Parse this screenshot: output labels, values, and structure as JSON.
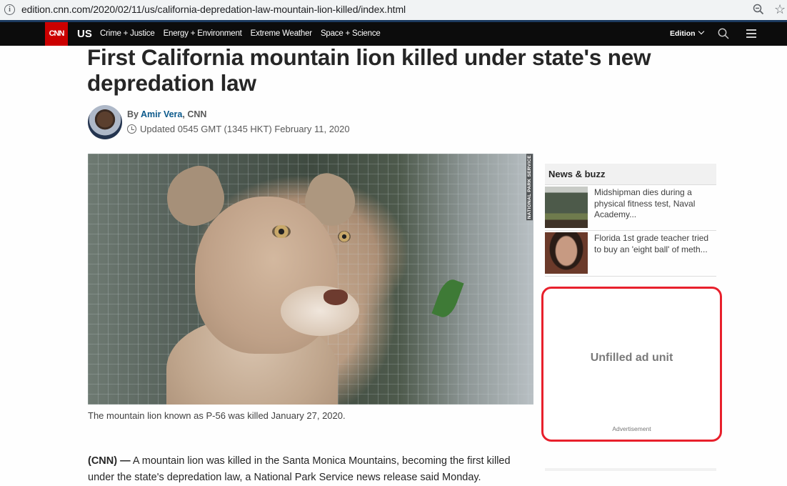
{
  "browser": {
    "url": "edition.cnn.com/2020/02/11/us/california-depredation-law-mountain-lion-killed/index.html",
    "icons": [
      "info-icon",
      "zoom-out-icon",
      "bookmark-star-icon"
    ]
  },
  "nav": {
    "logo": "CNN",
    "section": "US",
    "links": [
      "Crime + Justice",
      "Energy + Environment",
      "Extreme Weather",
      "Space + Science"
    ],
    "edition_label": "Edition",
    "icons": [
      "search-icon",
      "hamburger-menu-icon"
    ],
    "brand_color": "#cc0000"
  },
  "article": {
    "headline": "First California mountain lion killed under state's new depredation law",
    "byline_prefix": "By",
    "author": "Amir Vera",
    "outlet_suffix": ", CNN",
    "updated": "Updated 0545 GMT (1345 HKT) February 11, 2020",
    "image_credit": "NATIONAL PARK SERVICE",
    "caption": "The mountain lion known as P-56 was killed January 27, 2020.",
    "lead_dateline": "(CNN) —",
    "lead_text": " A mountain lion was killed in the Santa Monica Mountains, becoming the first killed under the state's depredation law, a National Park Service news release said Monday."
  },
  "sidebar": {
    "buzz_title": "News & buzz",
    "items": [
      {
        "text": "Midshipman dies during a physical fitness test, Naval Academy..."
      },
      {
        "text": "Florida 1st grade teacher tried to buy an 'eight ball' of meth..."
      }
    ],
    "ad": {
      "label": "Unfilled ad unit",
      "footer": "Advertisement",
      "highlight_color": "#e8202c"
    }
  }
}
